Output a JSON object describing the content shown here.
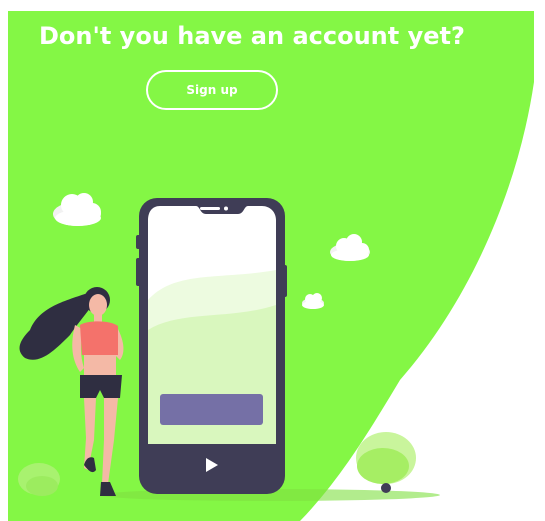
{
  "colors": {
    "brand_green": "#84f745",
    "white": "#ffffff",
    "phone_dark": "#3f3d56",
    "screen_button_purple": "#7570a6",
    "skin": "#f4b9a6",
    "top_coral": "#f4726b",
    "hair": "#2f2e41"
  },
  "panel": {
    "headline": "Don't you have an account yet?",
    "signup_label": "Sign up"
  },
  "icons": {
    "play": "play-icon"
  }
}
